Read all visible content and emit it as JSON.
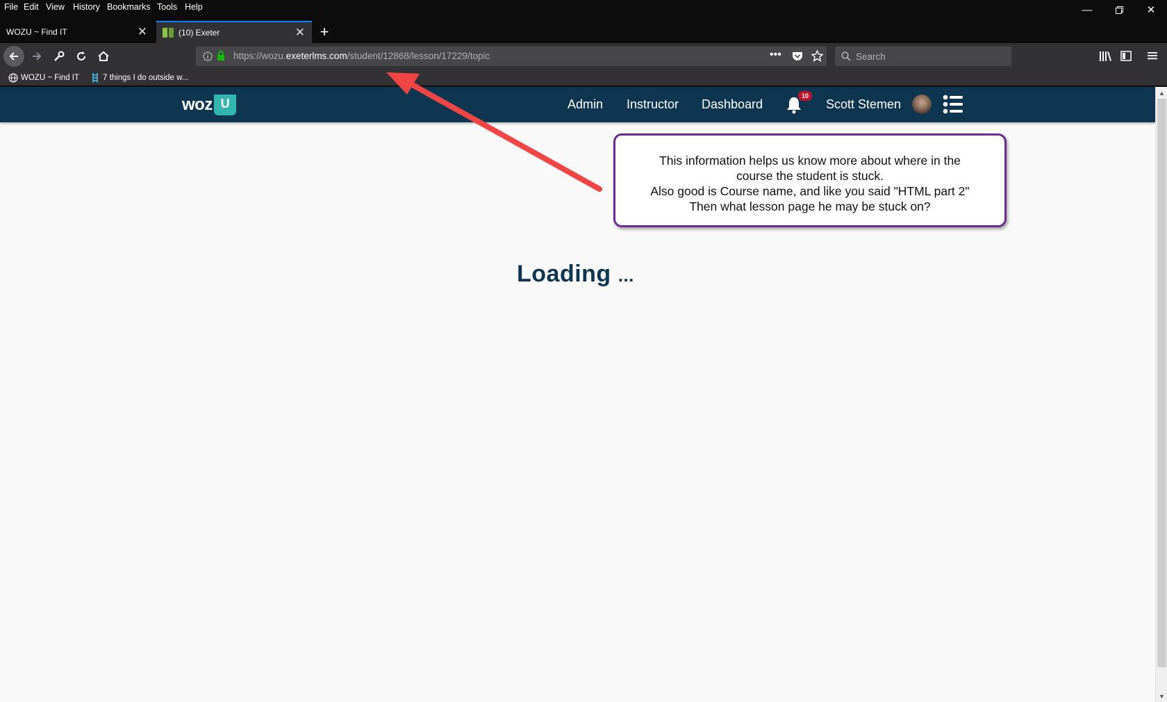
{
  "browser": {
    "menus": [
      "File",
      "Edit",
      "View",
      "History",
      "Bookmarks",
      "Tools",
      "Help"
    ],
    "tabs": [
      {
        "title": "WOZU ~ Find IT",
        "active": false
      },
      {
        "title": "(10) Exeter",
        "active": true
      }
    ],
    "url": {
      "prefix": "https://wozu.",
      "domain": "exeterlms.com",
      "path": "/student/12868/lesson/17229/topic"
    },
    "search_placeholder": "Search",
    "bookmarks": [
      {
        "label": "WOZU ~ Find IT",
        "icon": "globe-icon"
      },
      {
        "label": "7 things I do outside w...",
        "icon": "ladder-icon"
      }
    ],
    "accent_color": "#0a84ff"
  },
  "site": {
    "logo_text": "woz",
    "logo_u": "U",
    "nav_links": [
      "Admin",
      "Instructor",
      "Dashboard"
    ],
    "notification_count": "10",
    "user_name": "Scott Stemen",
    "header_color": "#0f3650",
    "brand_color": "#34b6b0"
  },
  "main": {
    "loading_text": "Loading",
    "loading_dots": "..."
  },
  "annotation": {
    "lines": [
      "This information helps us know more about where in the",
      "course the student is stuck.",
      "Also good is Course name, and like you said \"HTML part 2\"",
      "Then what lesson page he may be stuck on?"
    ],
    "border_color": "#6a2c91",
    "arrow_color": "#f04545"
  }
}
